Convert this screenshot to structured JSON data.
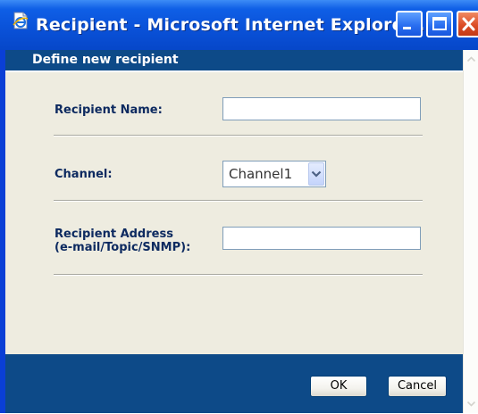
{
  "window": {
    "title": "Recipient - Microsoft Internet Explorer ...",
    "app_icon": "ie-page-icon",
    "controls": [
      "minimize-icon",
      "maximize-icon",
      "close-icon"
    ]
  },
  "dialog": {
    "header": "Define new recipient",
    "fields": {
      "recipient_name": {
        "label": "Recipient Name:",
        "value": ""
      },
      "channel": {
        "label": "Channel:",
        "selected": "Channel1"
      },
      "recipient_address": {
        "label_line1": "Recipient Address",
        "label_line2": "(e-mail/Topic/SNMP):",
        "value": ""
      }
    },
    "buttons": {
      "ok": "OK",
      "cancel": "Cancel"
    }
  },
  "colors": {
    "titlebar": "#0a52d9",
    "header_bar": "#0d4a88",
    "panel": "#eeece0",
    "label_text": "#0d2a60"
  }
}
